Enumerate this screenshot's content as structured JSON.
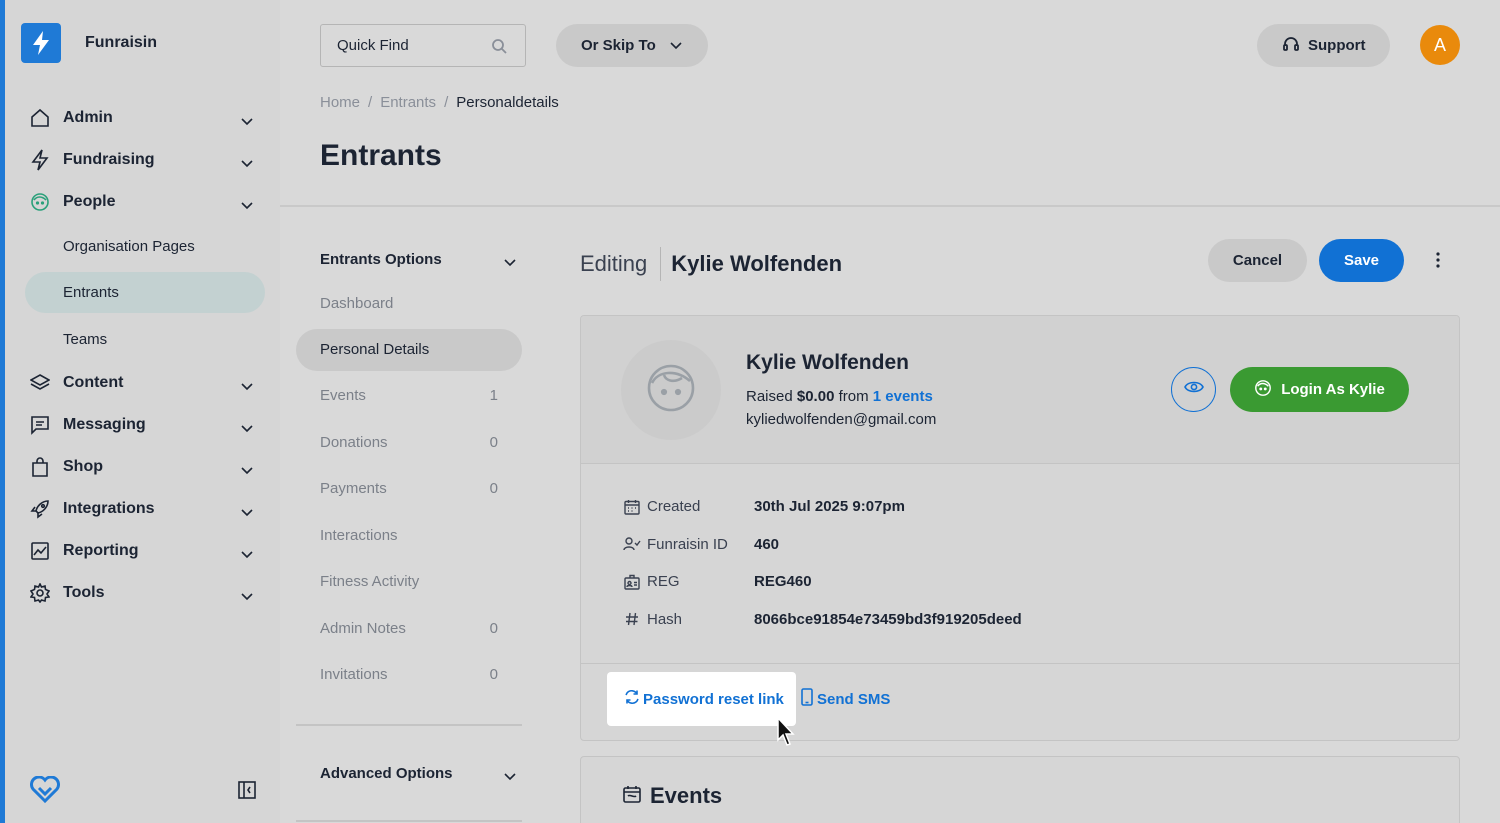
{
  "brand": {
    "name": "Funraisin"
  },
  "sidebar": {
    "items": [
      {
        "label": "Admin",
        "icon": "home-icon"
      },
      {
        "label": "Fundraising",
        "icon": "bolt-icon"
      },
      {
        "label": "People",
        "icon": "face-icon"
      },
      {
        "label": "Content",
        "icon": "layers-icon"
      },
      {
        "label": "Messaging",
        "icon": "message-icon"
      },
      {
        "label": "Shop",
        "icon": "bag-icon"
      },
      {
        "label": "Integrations",
        "icon": "rocket-icon"
      },
      {
        "label": "Reporting",
        "icon": "chart-icon"
      },
      {
        "label": "Tools",
        "icon": "gear-icon"
      }
    ],
    "people_sub": [
      "Organisation Pages",
      "Entrants",
      "Teams"
    ],
    "active_sub": "Entrants"
  },
  "topbar": {
    "search_placeholder": "Quick Find",
    "skip_label": "Or Skip To",
    "support_label": "Support",
    "avatar_initial": "A"
  },
  "breadcrumb": [
    "Home",
    "Entrants",
    "Personaldetails"
  ],
  "page_title": "Entrants",
  "options": {
    "heading": "Entrants Options",
    "items": [
      {
        "label": "Dashboard",
        "count": ""
      },
      {
        "label": "Personal Details",
        "count": ""
      },
      {
        "label": "Events",
        "count": "1"
      },
      {
        "label": "Donations",
        "count": "0"
      },
      {
        "label": "Payments",
        "count": "0"
      },
      {
        "label": "Interactions",
        "count": ""
      },
      {
        "label": "Fitness Activity",
        "count": ""
      },
      {
        "label": "Admin Notes",
        "count": "0"
      },
      {
        "label": "Invitations",
        "count": "0"
      }
    ],
    "advanced": "Advanced Options"
  },
  "editing": {
    "prefix": "Editing",
    "name": "Kylie Wolfenden",
    "cancel": "Cancel",
    "save": "Save"
  },
  "profile": {
    "name": "Kylie Wolfenden",
    "raised_prefix": "Raised",
    "raised_amount": "$0.00",
    "raised_from": "from",
    "events_link": "1 events",
    "email": "kyliedwolfenden@gmail.com",
    "login_label": "Login As Kylie"
  },
  "details": [
    {
      "key": "Created",
      "value": "30th Jul 2025 9:07pm",
      "icon": "calendar-icon"
    },
    {
      "key": "Funraisin ID",
      "value": "460",
      "icon": "user-check-icon"
    },
    {
      "key": "REG",
      "value": "REG460",
      "icon": "id-card-icon"
    },
    {
      "key": "Hash",
      "value": "8066bce91854e73459bd3f919205deed",
      "icon": "hash-icon"
    }
  ],
  "actions": {
    "password_reset": "Password reset link",
    "send_sms": "Send SMS"
  },
  "events_section": {
    "title": "Events"
  },
  "colors": {
    "primary": "#1171d4",
    "success": "#3a9a32",
    "avatar": "#e98a0c"
  }
}
